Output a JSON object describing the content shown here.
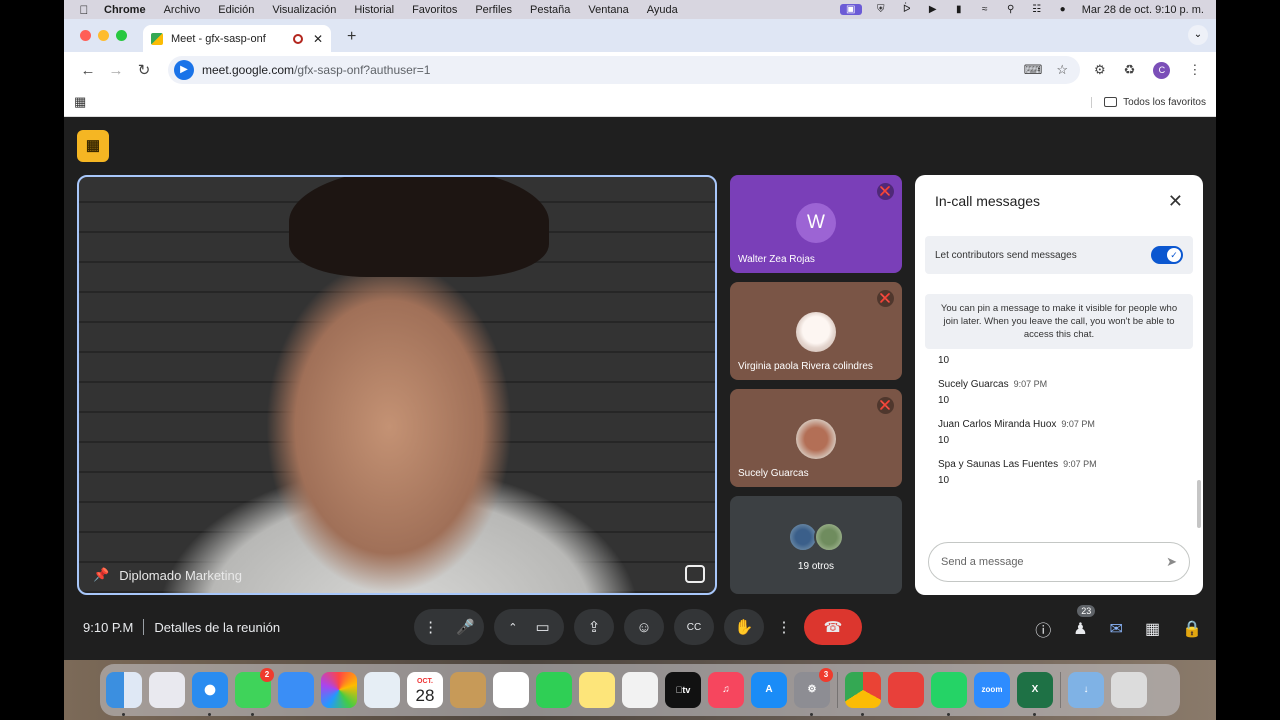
{
  "menubar": {
    "items": [
      "Chrome",
      "Archivo",
      "Edición",
      "Visualización",
      "Historial",
      "Favoritos",
      "Perfiles",
      "Pestaña",
      "Ventana",
      "Ayuda"
    ],
    "datetime": "Mar 28 de oct.  9:10 p. m."
  },
  "browser": {
    "tab_title": "Meet - gfx-sasp-onf",
    "url_host": "meet.google.com",
    "url_path": "/gfx-sasp-onf?authuser=1",
    "profile_initial": "C",
    "bookmarks_all": "Todos los favoritos"
  },
  "meeting": {
    "main_speaker_label": "Diplomado Marketing",
    "participants": [
      {
        "name": "Walter Zea Rojas",
        "initial": "W",
        "muted": true
      },
      {
        "name": "Virginia paola Rivera colindres",
        "muted": true
      },
      {
        "name": "Sucely Guarcas",
        "muted": true
      }
    ],
    "others_label": "19 otros",
    "time": "9:10 P.M",
    "details": "Detalles de la reunión",
    "people_count": "23"
  },
  "chat": {
    "title": "In-call messages",
    "toggle_label": "Let contributors send messages",
    "toggle_on": true,
    "info": "You can pin a message to make it visible for people who join later. When you leave the call, you won't be able to access this chat.",
    "messages": [
      {
        "sender": "",
        "time": "",
        "text": "10"
      },
      {
        "sender": "Sucely Guarcas",
        "time": "9:07 PM",
        "text": "10"
      },
      {
        "sender": "Juan Carlos Miranda Huox",
        "time": "9:07 PM",
        "text": "10"
      },
      {
        "sender": "Spa y Saunas Las Fuentes",
        "time": "9:07 PM",
        "text": "10"
      }
    ],
    "input_placeholder": "Send a message"
  },
  "dock": {
    "calendar_month": "OCT.",
    "calendar_day": "28",
    "messages_badge": "2",
    "settings_badge": "3"
  },
  "colors": {
    "accent": "#0b57d0",
    "hangup": "#dc362e",
    "meet_bg": "#1f1f1f",
    "host_badge": "#f5b623"
  }
}
